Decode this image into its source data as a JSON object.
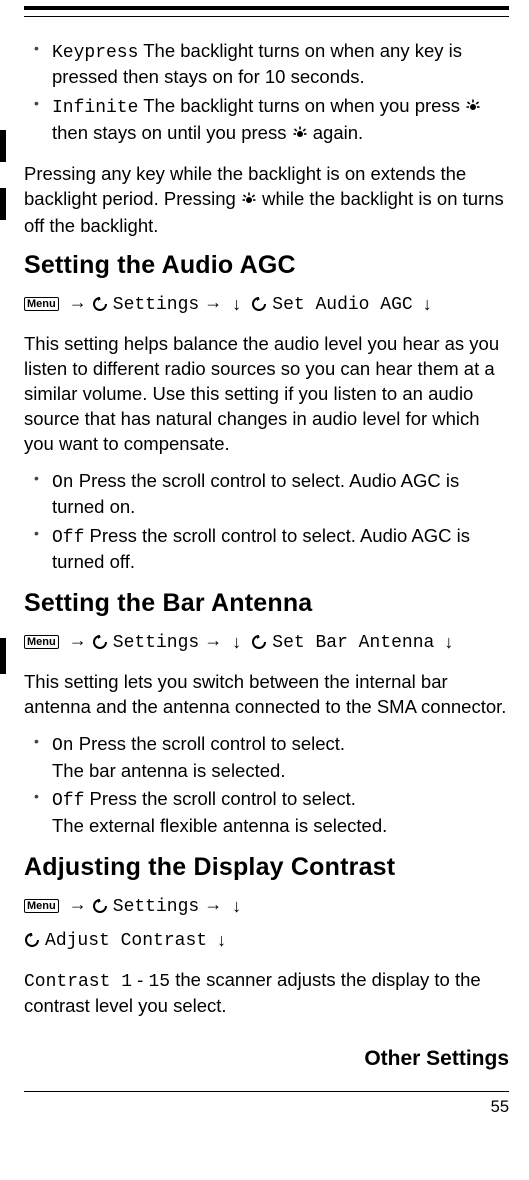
{
  "bullets1": {
    "item1": {
      "code": "Keypress",
      "text": " The backlight turns on when any key is pressed then stays on for 10 seconds."
    },
    "item2": {
      "code": "Infinite",
      "text_a": " The backlight turns on when you press ",
      "text_b": " then stays on until you press ",
      "text_c": " again."
    }
  },
  "para1": {
    "a": "Pressing any key while the backlight is on extends the backlight period. Pressing ",
    "b": " while the backlight is on turns off the backlight."
  },
  "section_agc": {
    "heading": "Setting the Audio AGC",
    "nav": {
      "menu": "Menu",
      "settings": "Settings",
      "item": "Set Audio AGC"
    },
    "para": "This setting helps balance the audio level you hear as you listen to different radio sources so you can hear them at a similar volume. Use this setting if you listen to an audio source that has natural changes in audio level for which you want to compensate.",
    "on": {
      "code": "On",
      "text": " Press the scroll control to select. Audio AGC is turned on."
    },
    "off": {
      "code": "Off",
      "text": " Press the scroll control to select. Audio AGC is turned off."
    }
  },
  "section_bar": {
    "heading": "Setting the Bar Antenna",
    "nav": {
      "menu": "Menu",
      "settings": "Settings",
      "item": "Set Bar Antenna"
    },
    "para": "This setting lets you switch between the internal bar antenna and the antenna connected to the SMA connector.",
    "on": {
      "code": "On",
      "text1": " Press the scroll control to select.",
      "text2": "The bar antenna is selected."
    },
    "off": {
      "code": "Off",
      "text1": " Press the scroll control to select.",
      "text2": "The external flexible antenna is selected."
    }
  },
  "section_contrast": {
    "heading": "Adjusting the Display Contrast",
    "nav": {
      "menu": "Menu",
      "settings": "Settings",
      "item": "Adjust Contrast"
    },
    "code_a": "Contrast 1",
    "dash": " - ",
    "code_b": "15",
    "text": " the scanner adjusts the display to the contrast level you select."
  },
  "footer": {
    "title": "Other Settings",
    "page": "55"
  },
  "glyphs": {
    "arrow_right": "→",
    "arrow_down": "↓"
  }
}
